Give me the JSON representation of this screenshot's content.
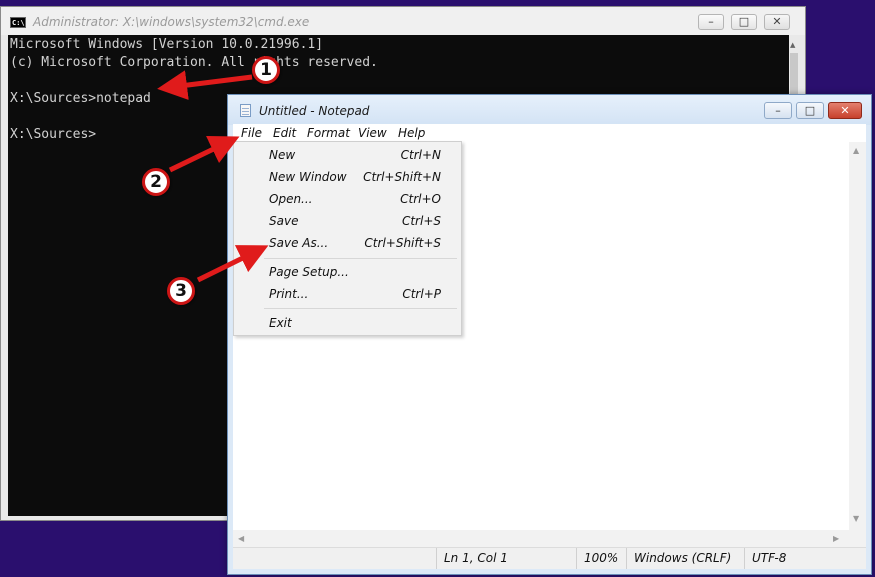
{
  "cmd": {
    "title": "Administrator: X:\\windows\\system32\\cmd.exe",
    "icon_text": "C:\\",
    "lines": [
      "Microsoft Windows [Version 10.0.21996.1]",
      "(c) Microsoft Corporation. All rights reserved.",
      "",
      "X:\\Sources>notepad",
      "",
      "X:\\Sources>"
    ],
    "buttons": {
      "minimize": "–",
      "maximize": "□",
      "close": "✕"
    }
  },
  "notepad": {
    "title": "Untitled - Notepad",
    "buttons": {
      "minimize": "–",
      "maximize": "□",
      "close": "✕"
    },
    "menu": [
      "File",
      "Edit",
      "Format",
      "View",
      "Help"
    ],
    "file_menu": [
      {
        "label": "New",
        "shortcut": "Ctrl+N"
      },
      {
        "label": "New Window",
        "shortcut": "Ctrl+Shift+N"
      },
      {
        "label": "Open...",
        "shortcut": "Ctrl+O"
      },
      {
        "label": "Save",
        "shortcut": "Ctrl+S"
      },
      {
        "label": "Save As...",
        "shortcut": "Ctrl+Shift+S"
      },
      {
        "label": "Page Setup...",
        "shortcut": ""
      },
      {
        "label": "Print...",
        "shortcut": "Ctrl+P"
      },
      {
        "label": "Exit",
        "shortcut": ""
      }
    ],
    "status": {
      "position": "Ln 1, Col 1",
      "zoom": "100%",
      "line_ending": "Windows (CRLF)",
      "encoding": "UTF-8"
    }
  },
  "annotations": {
    "badges": [
      "1",
      "2",
      "3"
    ],
    "arrow_color": "#e01b1b",
    "badge_border_color": "#cc1515"
  },
  "colors": {
    "desktop": "#2a0f6e",
    "console_bg": "#0c0c0c",
    "console_text": "#d2d2d2"
  }
}
